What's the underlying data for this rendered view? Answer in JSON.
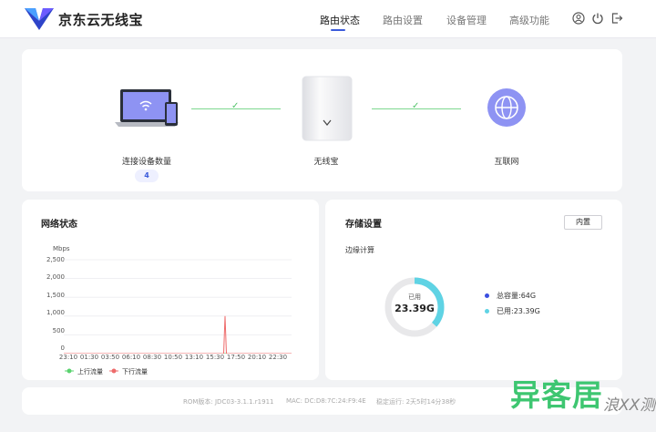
{
  "header": {
    "brand": "京东云无线宝",
    "nav": [
      "路由状态",
      "路由设置",
      "设备管理",
      "高级功能"
    ]
  },
  "topology": {
    "devices_label": "连接设备数量",
    "device_count": "4",
    "router_label": "无线宝",
    "internet_label": "互联网"
  },
  "network": {
    "title": "网络状态",
    "chart_data": {
      "type": "line",
      "ylabel": "Mbps",
      "y_ticks": [
        "2,500",
        "2,000",
        "1,500",
        "1,000",
        "500",
        "0"
      ],
      "ylim": [
        0,
        2500
      ],
      "x": [
        "23:10",
        "01:30",
        "03:50",
        "06:10",
        "08:30",
        "10:50",
        "13:10",
        "15:30",
        "17:50",
        "20:10",
        "22:30"
      ],
      "series": [
        {
          "name": "上行流量",
          "color": "#5ad36f",
          "values": [
            0,
            0,
            0,
            0,
            0,
            0,
            0,
            0,
            0,
            0,
            0
          ]
        },
        {
          "name": "下行流量",
          "color": "#ee6b6b",
          "values": [
            0,
            0,
            0,
            0,
            0,
            0,
            0,
            0,
            0,
            0,
            0
          ],
          "spike": {
            "x": "15:30",
            "value": 1000
          }
        }
      ],
      "grid": true,
      "legend": "bottom-left"
    }
  },
  "storage": {
    "title": "存储设置",
    "builtin_button": "内置",
    "subtitle": "边缘计算",
    "used_label": "已用",
    "used_value": "23.39G",
    "total_legend": "总容量:64G",
    "used_legend": "已用:23.39G",
    "used_fraction": 0.365,
    "colors": {
      "total": "#3b4fe0",
      "used": "#5fd3e4",
      "track": "#e8e8ea"
    }
  },
  "footer": {
    "rom": "ROM版本: JDC03-3.1.1.r1911",
    "mac": "MAC: DC:D8:7C:24:F9:4E",
    "uptime": "稳定运行: 2天5时14分38秒"
  },
  "watermark": {
    "main": "异客居",
    "sub": "浪XX测"
  },
  "icons": [
    "logo-icon",
    "user-icon",
    "power-icon",
    "logout-icon",
    "laptop-phone-icon",
    "router-icon",
    "globe-icon",
    "wifi-icon",
    "check-icon"
  ]
}
